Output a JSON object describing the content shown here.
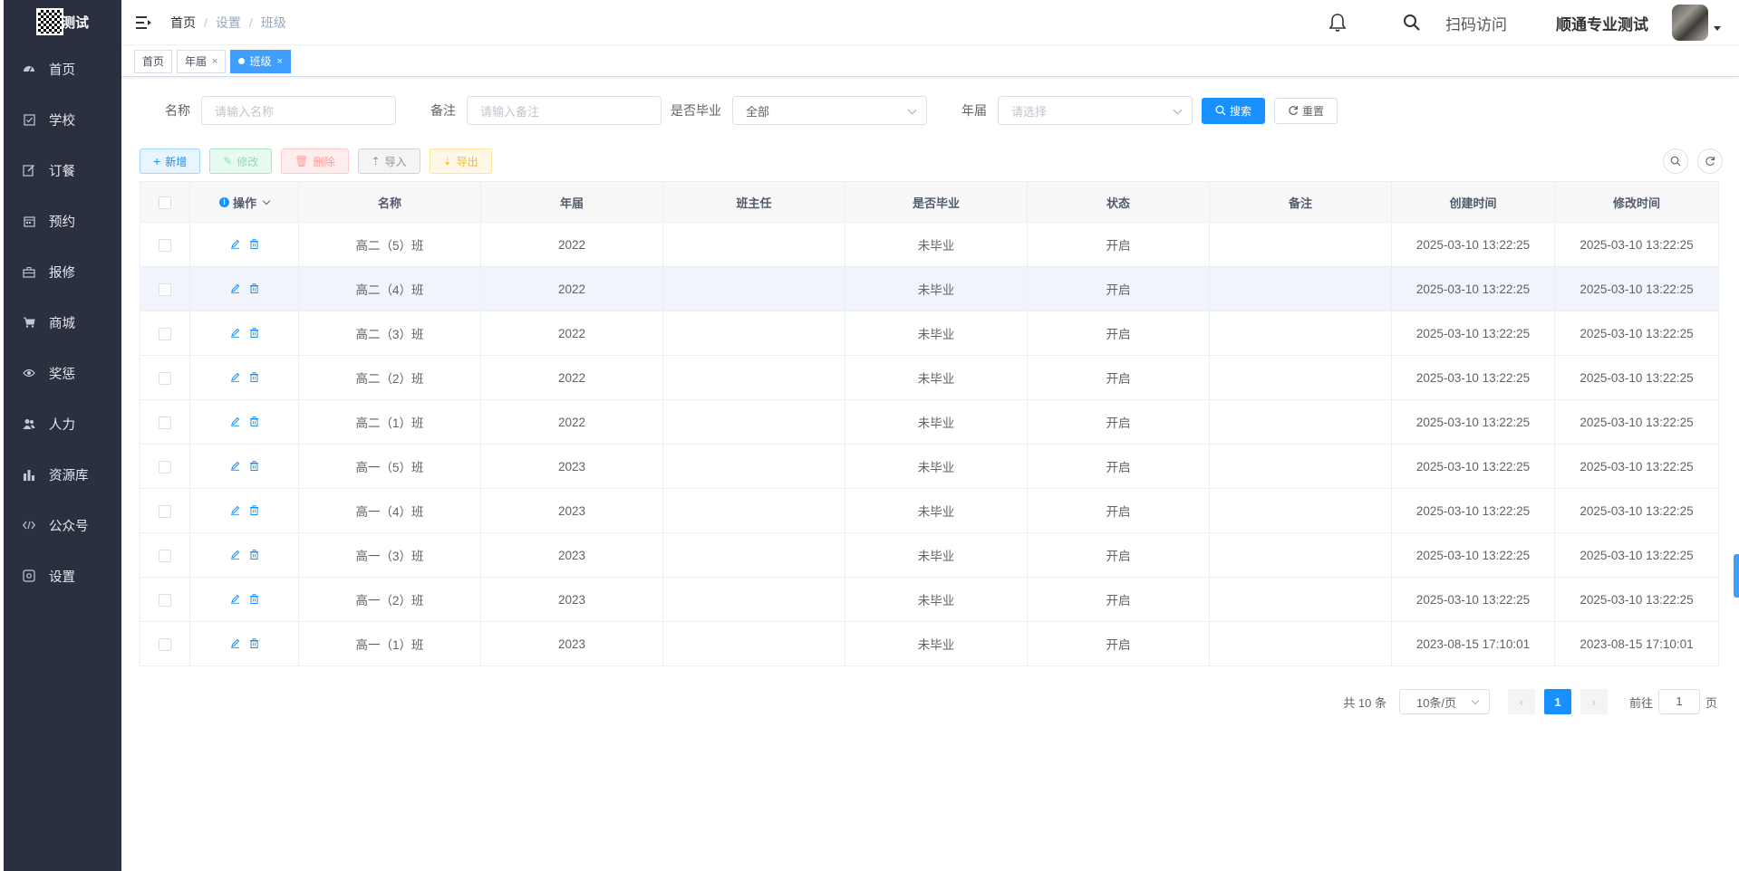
{
  "app": {
    "title": "测试"
  },
  "sidebar": {
    "items": [
      {
        "label": "首页",
        "icon": "dashboard-icon"
      },
      {
        "label": "学校",
        "icon": "checkbox-icon"
      },
      {
        "label": "订餐",
        "icon": "edit-icon"
      },
      {
        "label": "预约",
        "icon": "calendar-icon"
      },
      {
        "label": "报修",
        "icon": "toolbox-icon"
      },
      {
        "label": "商城",
        "icon": "cart-icon"
      },
      {
        "label": "奖惩",
        "icon": "eye-icon"
      },
      {
        "label": "人力",
        "icon": "peoples-icon"
      },
      {
        "label": "资源库",
        "icon": "chart-icon"
      },
      {
        "label": "公众号",
        "icon": "code-icon"
      },
      {
        "label": "设置",
        "icon": "settings-icon"
      }
    ]
  },
  "header": {
    "breadcrumb": [
      "首页",
      "设置",
      "班级"
    ],
    "scan_label": "扫码访问",
    "user_name": "顺通专业测试"
  },
  "tags": [
    {
      "label": "首页",
      "closable": false,
      "active": false
    },
    {
      "label": "年届",
      "closable": true,
      "active": false
    },
    {
      "label": "班级",
      "closable": true,
      "active": true
    }
  ],
  "search": {
    "name_label": "名称",
    "name_placeholder": "请输入名称",
    "remark_label": "备注",
    "remark_placeholder": "请输入备注",
    "graduated_label": "是否毕业",
    "graduated_value": "全部",
    "year_label": "年届",
    "year_placeholder": "请选择",
    "search_btn": "搜索",
    "reset_btn": "重置"
  },
  "toolbar": {
    "add": "新增",
    "edit": "修改",
    "delete": "删除",
    "import": "导入",
    "export": "导出"
  },
  "table": {
    "columns": [
      "操作",
      "名称",
      "年届",
      "班主任",
      "是否毕业",
      "状态",
      "备注",
      "创建时间",
      "修改时间"
    ],
    "rows": [
      {
        "name": "高二（5）班",
        "year": "2022",
        "teacher": "",
        "graduated": "未毕业",
        "status": "开启",
        "remark": "",
        "created": "2025-03-10 13:22:25",
        "modified": "2025-03-10 13:22:25"
      },
      {
        "name": "高二（4）班",
        "year": "2022",
        "teacher": "",
        "graduated": "未毕业",
        "status": "开启",
        "remark": "",
        "created": "2025-03-10 13:22:25",
        "modified": "2025-03-10 13:22:25"
      },
      {
        "name": "高二（3）班",
        "year": "2022",
        "teacher": "",
        "graduated": "未毕业",
        "status": "开启",
        "remark": "",
        "created": "2025-03-10 13:22:25",
        "modified": "2025-03-10 13:22:25"
      },
      {
        "name": "高二（2）班",
        "year": "2022",
        "teacher": "",
        "graduated": "未毕业",
        "status": "开启",
        "remark": "",
        "created": "2025-03-10 13:22:25",
        "modified": "2025-03-10 13:22:25"
      },
      {
        "name": "高二（1）班",
        "year": "2022",
        "teacher": "",
        "graduated": "未毕业",
        "status": "开启",
        "remark": "",
        "created": "2025-03-10 13:22:25",
        "modified": "2025-03-10 13:22:25"
      },
      {
        "name": "高一（5）班",
        "year": "2023",
        "teacher": "",
        "graduated": "未毕业",
        "status": "开启",
        "remark": "",
        "created": "2025-03-10 13:22:25",
        "modified": "2025-03-10 13:22:25"
      },
      {
        "name": "高一（4）班",
        "year": "2023",
        "teacher": "",
        "graduated": "未毕业",
        "status": "开启",
        "remark": "",
        "created": "2025-03-10 13:22:25",
        "modified": "2025-03-10 13:22:25"
      },
      {
        "name": "高一（3）班",
        "year": "2023",
        "teacher": "",
        "graduated": "未毕业",
        "status": "开启",
        "remark": "",
        "created": "2025-03-10 13:22:25",
        "modified": "2025-03-10 13:22:25"
      },
      {
        "name": "高一（2）班",
        "year": "2023",
        "teacher": "",
        "graduated": "未毕业",
        "status": "开启",
        "remark": "",
        "created": "2025-03-10 13:22:25",
        "modified": "2025-03-10 13:22:25"
      },
      {
        "name": "高一（1）班",
        "year": "2023",
        "teacher": "",
        "graduated": "未毕业",
        "status": "开启",
        "remark": "",
        "created": "2023-08-15 17:10:01",
        "modified": "2023-08-15 17:10:01"
      }
    ]
  },
  "pagination": {
    "total_text": "共 10 条",
    "page_size": "10条/页",
    "current_page": "1",
    "goto_label": "前往",
    "goto_value": "1",
    "page_suffix": "页"
  },
  "colors": {
    "sidebar_bg": "#2b3040",
    "primary": "#1890ff"
  }
}
